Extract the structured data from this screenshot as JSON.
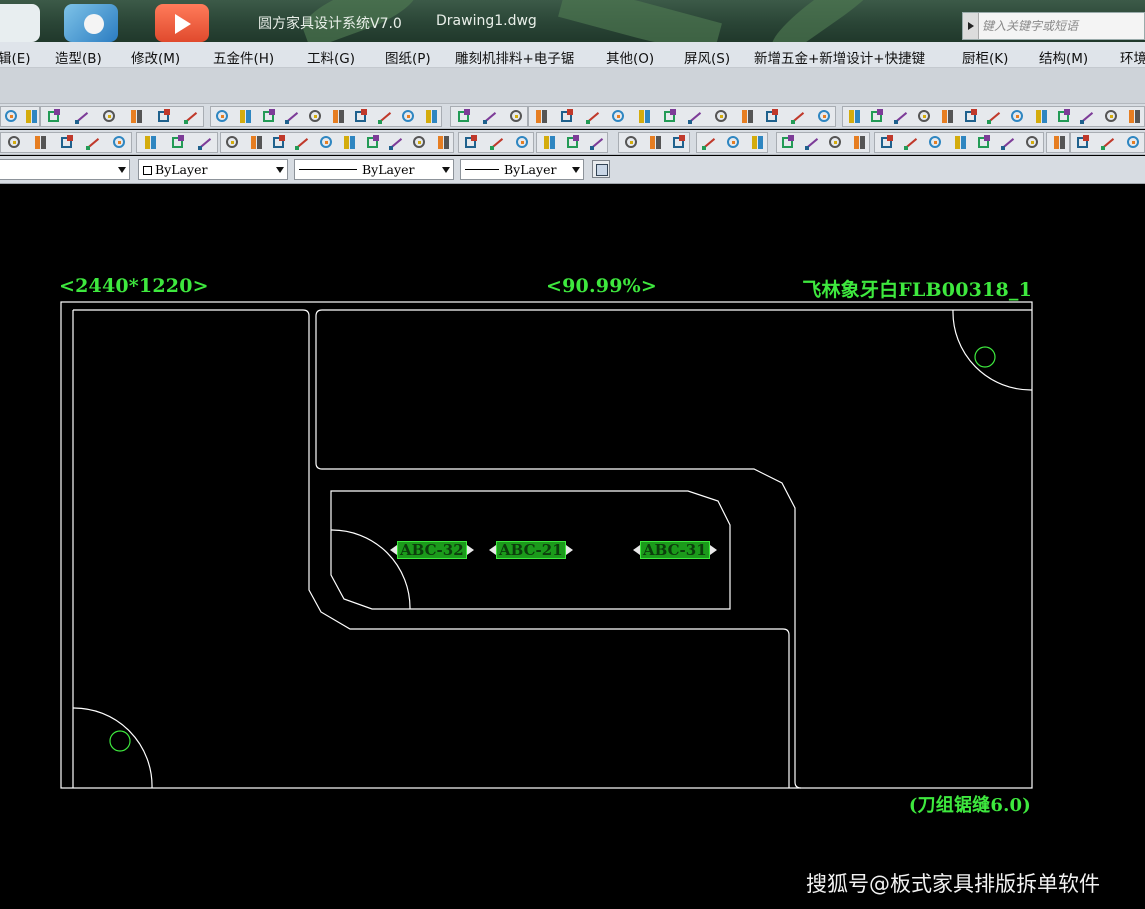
{
  "window": {
    "app_title": "圆方家具设计系统V7.0",
    "document_title": "Drawing1.dwg",
    "search_placeholder": "键入关键字或短语"
  },
  "menu": {
    "items": [
      {
        "label": "辑(E)"
      },
      {
        "label": "造型(B)"
      },
      {
        "label": "修改(M)"
      },
      {
        "label": "五金件(H)"
      },
      {
        "label": "工料(G)"
      },
      {
        "label": "图纸(P)"
      },
      {
        "label": "雕刻机排料+电子锯"
      },
      {
        "label": "其他(O)"
      },
      {
        "label": "屏风(S)"
      },
      {
        "label": "新增五金+新增设计+快捷键"
      },
      {
        "label": "厨柜(K)"
      },
      {
        "label": "结构(M)"
      },
      {
        "label": "环境"
      }
    ]
  },
  "properties": {
    "color": "ByLayer",
    "linetype": "ByLayer",
    "lineweight": "ByLayer"
  },
  "drawing": {
    "sheet_size_label": "<2440*1220>",
    "utilization_label": "<90.99%>",
    "material_label": "飞林象牙白FLB00318_1",
    "kerf_label": "(刀组锯缝6.0)",
    "part_tags": [
      "ABC-32",
      "ABC-21",
      "ABC-31"
    ],
    "line_color": "#ffffff",
    "label_color": "#3ee83e"
  },
  "watermark": "搜狐号@板式家具排版拆单软件",
  "colors": {
    "titlebar": "#2a4536",
    "menubar": "#dfe4ea",
    "toolbar": "#d7dce2",
    "canvas": "#000000"
  }
}
